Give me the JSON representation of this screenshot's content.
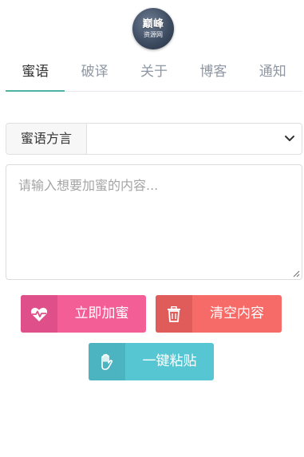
{
  "logo": {
    "line1": "巅峰",
    "line2": "资源网"
  },
  "tabs": [
    {
      "label": "蜜语",
      "active": true
    },
    {
      "label": "破译",
      "active": false
    },
    {
      "label": "关于",
      "active": false
    },
    {
      "label": "博客",
      "active": false
    },
    {
      "label": "通知",
      "active": false
    }
  ],
  "dialect": {
    "label": "蜜语方言",
    "value": ""
  },
  "input": {
    "placeholder": "请输入想要加蜜的内容..."
  },
  "buttons": {
    "encrypt": "立即加蜜",
    "clear": "清空内容",
    "paste": "一键粘贴"
  },
  "colors": {
    "accent_tab": "#4fb3a1",
    "encrypt": "#f35e97",
    "clear": "#f66a68",
    "paste": "#56c6d3"
  }
}
